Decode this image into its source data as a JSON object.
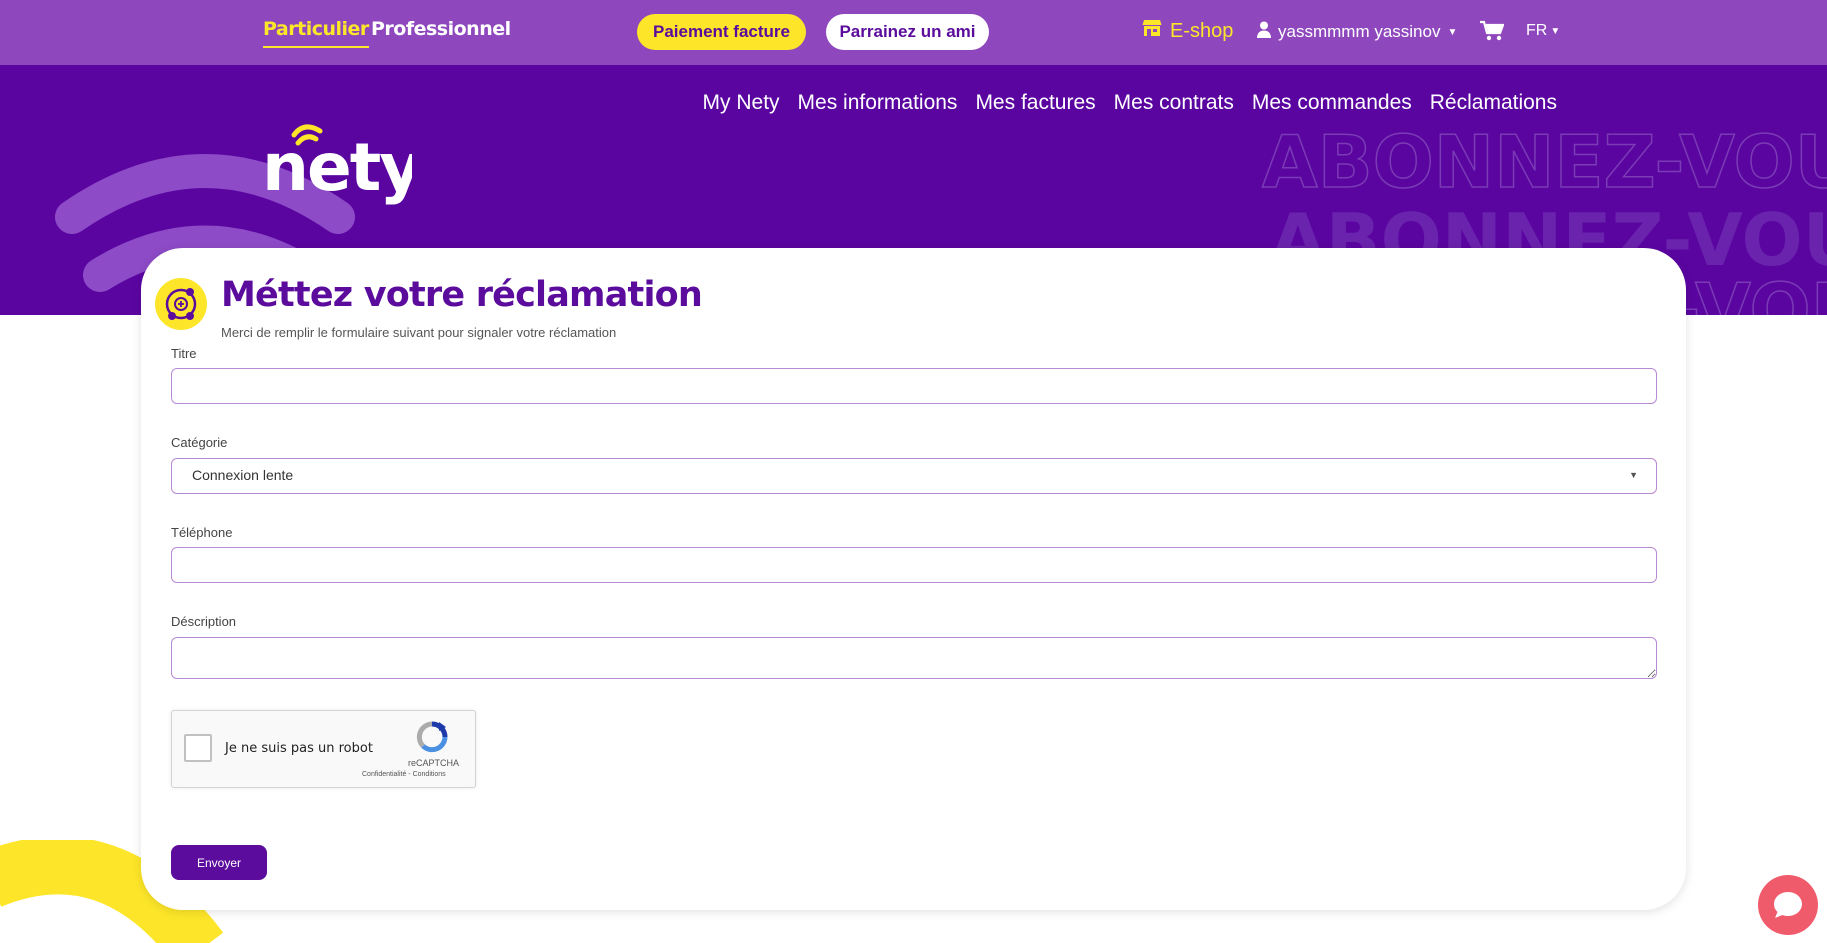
{
  "topbar": {
    "segments": [
      "Particulier",
      "Professionnel"
    ],
    "pay_button": "Paiement facture",
    "referral_button": "Parrainez un ami",
    "eshop": "E-shop",
    "user_name": "yassmmmm yassinov",
    "language": "FR"
  },
  "hero": {
    "logo_text": "nety",
    "nav": [
      "My Nety",
      "Mes informations",
      "Mes factures",
      "Mes contrats",
      "Mes commandes",
      "Réclamations"
    ],
    "background_text": "ABONNEZ-VOUS"
  },
  "form": {
    "title": "Méttez votre réclamation",
    "subtitle": "Merci de remplir le formulaire suivant pour signaler votre réclamation",
    "title_label": "Titre",
    "title_value": "",
    "category_label": "Catégorie",
    "category_value": "Connexion lente",
    "phone_label": "Téléphone",
    "phone_value": "",
    "description_label": "Déscription",
    "description_value": "",
    "captcha_text": "Je ne suis pas un robot",
    "captcha_brand": "reCAPTCHA",
    "captcha_links": "Confidentialité - Conditions",
    "submit": "Envoyer"
  },
  "colors": {
    "topbar": "#8e47bd",
    "hero": "#5b05a1",
    "accent_yellow": "#fde629",
    "brand_purple": "#5b0c9c",
    "chat": "#f05b6c"
  },
  "icons": [
    "store-icon",
    "user-icon",
    "cart-icon",
    "complaint-icon",
    "recaptcha-icon",
    "chat-icon"
  ]
}
